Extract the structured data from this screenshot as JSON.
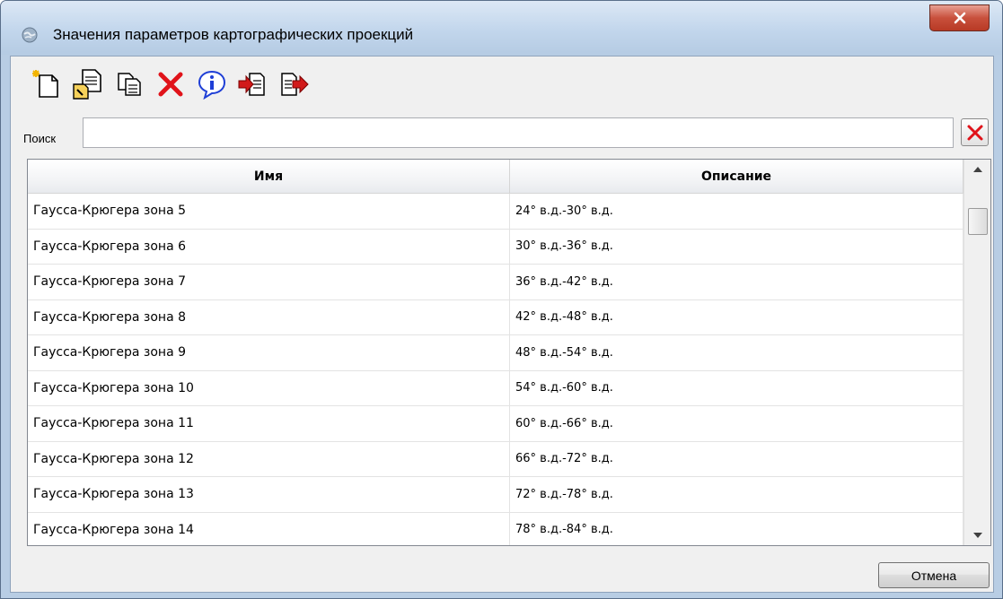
{
  "window": {
    "title": "Значения параметров картографических проекций",
    "close_icon": "close-icon"
  },
  "toolbar": {
    "buttons": [
      {
        "icon": "new-document-icon"
      },
      {
        "icon": "edit-document-icon"
      },
      {
        "icon": "copy-icon"
      },
      {
        "icon": "delete-icon"
      },
      {
        "icon": "info-icon"
      },
      {
        "icon": "import-icon"
      },
      {
        "icon": "export-icon"
      }
    ]
  },
  "search": {
    "label": "Поиск",
    "value": "",
    "placeholder": ""
  },
  "table": {
    "columns": [
      "Имя",
      "Описание"
    ],
    "rows": [
      {
        "name": "Гаусса-Крюгера зона  5",
        "desc": "24° в.д.-30° в.д."
      },
      {
        "name": "Гаусса-Крюгера зона  6",
        "desc": "30° в.д.-36° в.д."
      },
      {
        "name": "Гаусса-Крюгера зона  7",
        "desc": "36° в.д.-42° в.д."
      },
      {
        "name": "Гаусса-Крюгера зона  8",
        "desc": "42° в.д.-48° в.д."
      },
      {
        "name": "Гаусса-Крюгера зона  9",
        "desc": "48° в.д.-54° в.д."
      },
      {
        "name": "Гаусса-Крюгера зона 10",
        "desc": "54° в.д.-60° в.д."
      },
      {
        "name": "Гаусса-Крюгера зона 11",
        "desc": "60° в.д.-66° в.д."
      },
      {
        "name": "Гаусса-Крюгера зона 12",
        "desc": "66° в.д.-72° в.д."
      },
      {
        "name": "Гаусса-Крюгера зона 13",
        "desc": "72° в.д.-78° в.д."
      },
      {
        "name": "Гаусса-Крюгера зона 14",
        "desc": "78° в.д.-84° в.д."
      }
    ]
  },
  "footer": {
    "cancel_label": "Отмена"
  },
  "colors": {
    "titlebar": "#c2d6ec",
    "close_button": "#c8503c",
    "delete_red": "#e0131a",
    "info_blue": "#1f3fd6",
    "client_bg": "#f0f0f0"
  }
}
